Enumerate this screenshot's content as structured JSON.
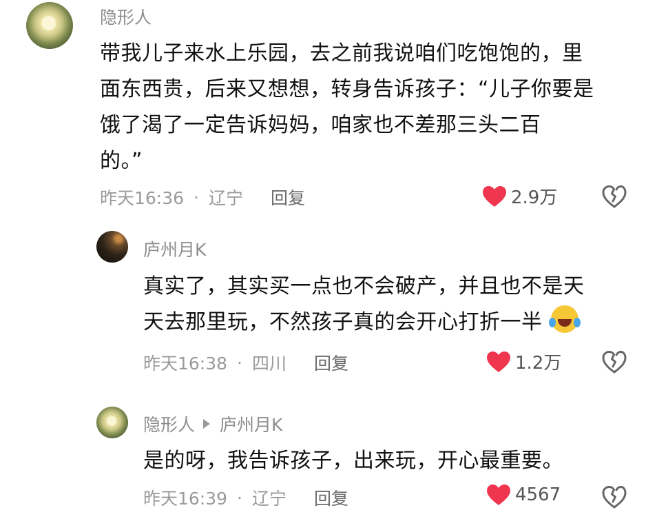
{
  "comments": [
    {
      "user": "隐形人",
      "lines": [
        "带我儿子来水上乐园，去之前我说咱们吃饱饱的，里",
        "面东西贵，后来又想想，转身告诉孩子：“儿子你要是",
        "饿了渴了一定告诉妈妈，咱家也不差那三头二百",
        "的。”"
      ],
      "time": "昨天16:36",
      "location": "辽宁",
      "reply_label": "回复",
      "likes": "2.9万"
    },
    {
      "user": "庐州月K",
      "lines": [
        "真实了，其实买一点也不会破产，并且也不是天",
        "天去那里玩，不然孩子真的会开心打折一半"
      ],
      "time": "昨天16:38",
      "location": "四川",
      "reply_label": "回复",
      "likes": "1.2万"
    },
    {
      "user": "隐形人",
      "reply_to": "庐州月K",
      "lines": [
        "是的呀，我告诉孩子，出来玩，开心最重要。"
      ],
      "time": "昨天16:39",
      "location": "辽宁",
      "reply_label": "回复",
      "likes": "4567"
    }
  ],
  "meta_separator": "·",
  "icons": {
    "heart": "heart-icon",
    "dislike": "broken-heart-icon",
    "emoji": "laughing-tears-emoji",
    "arrow": "reply-arrow-icon"
  },
  "colors": {
    "heart": "#f0364f",
    "meta": "#9a9a9a",
    "username": "#8e8e8e"
  }
}
